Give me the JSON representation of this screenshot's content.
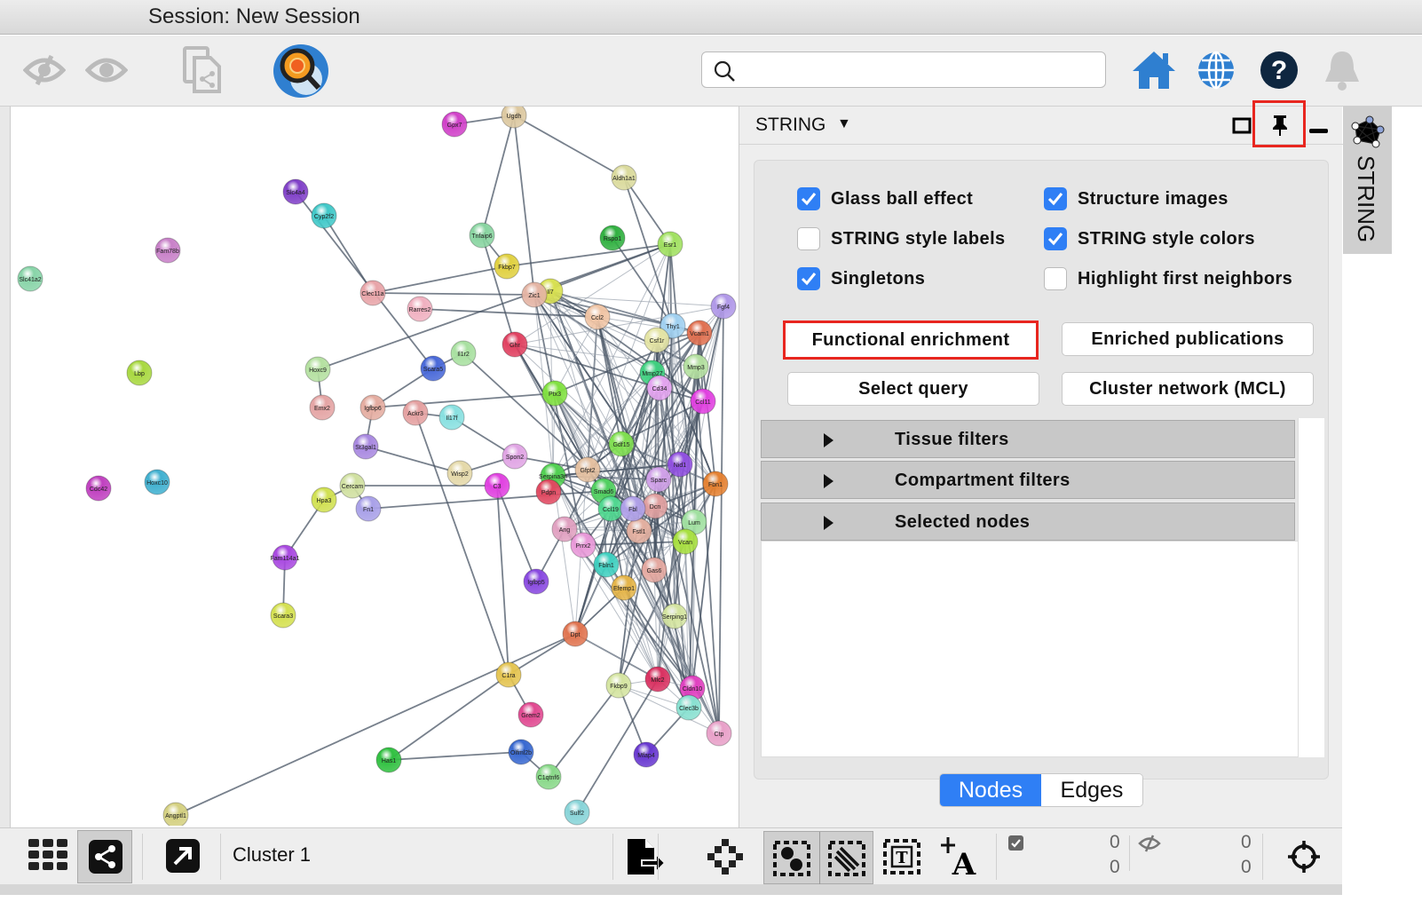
{
  "window": {
    "title": "Session: New Session"
  },
  "toolbar": {
    "icons": [
      "hide-icon",
      "show-icon",
      "new-network-from-selection-icon",
      "string-search-app-icon",
      "home-icon",
      "globe-icon",
      "help-icon",
      "notification-bell-icon"
    ],
    "search_value": "",
    "search_placeholder": ""
  },
  "panel": {
    "title": "STRING",
    "checkboxes": [
      {
        "label": "Glass ball effect",
        "checked": true
      },
      {
        "label": "Structure images",
        "checked": true
      },
      {
        "label": "STRING style labels",
        "checked": false
      },
      {
        "label": "STRING style colors",
        "checked": true
      },
      {
        "label": "Singletons",
        "checked": true
      },
      {
        "label": "Highlight first neighbors",
        "checked": false
      }
    ],
    "buttons": [
      "Functional enrichment",
      "Enriched publications",
      "Select query",
      "Cluster network (MCL)"
    ],
    "highlighted_button": "Functional enrichment",
    "filters": [
      "Tissue filters",
      "Compartment filters",
      "Selected nodes"
    ],
    "segmented": {
      "options": [
        "Nodes",
        "Edges"
      ],
      "selected": "Nodes"
    },
    "accent": "#2f7ff5",
    "highlight_color": "#e8261f"
  },
  "sidetab": {
    "label": "STRING"
  },
  "bottombar": {
    "network_name": "Cluster 1",
    "selected_nodes": "0",
    "selected_edges": "0",
    "hidden_nodes": "0",
    "hidden_edges": "0"
  },
  "network": {
    "nodes": [
      {
        "label": "Gpx7",
        "color": "#d040c8"
      },
      {
        "label": "Ugdh",
        "color": "#dcc8a0"
      },
      {
        "label": "Aldh1a1",
        "color": "#dada9c"
      },
      {
        "label": "Slc4a4",
        "color": "#8040c8"
      },
      {
        "label": "Cyp2f2",
        "color": "#40c8c8"
      },
      {
        "label": "Fam78b",
        "color": "#c880c8"
      },
      {
        "label": "Slc41a2",
        "color": "#88d4a8"
      },
      {
        "label": "Tnfaip6",
        "color": "#88d4a0"
      },
      {
        "label": "Rspo1",
        "color": "#30b040"
      },
      {
        "label": "Esr1",
        "color": "#a0e060"
      },
      {
        "label": "Fkbp7",
        "color": "#e0d040"
      },
      {
        "label": "Il7",
        "color": "#d8e050"
      },
      {
        "label": "Zic1",
        "color": "#e4b4a4"
      },
      {
        "label": "Clec11a",
        "color": "#e8a4a8"
      },
      {
        "label": "Rarres2",
        "color": "#f0b0c0"
      },
      {
        "label": "Ccl2",
        "color": "#f0c4a4"
      },
      {
        "label": "Thy1",
        "color": "#a0d0f0"
      },
      {
        "label": "Vcam1",
        "color": "#e07050"
      },
      {
        "label": "Csf1r",
        "color": "#e4e4a4"
      },
      {
        "label": "Ghr",
        "color": "#e04060"
      },
      {
        "label": "Il1r2",
        "color": "#a8e0a0"
      },
      {
        "label": "Hoxc9",
        "color": "#b4e0a0"
      },
      {
        "label": "Scara5",
        "color": "#4868d8"
      },
      {
        "label": "Lbp",
        "color": "#a8d840"
      },
      {
        "label": "Mmp27",
        "color": "#40d080"
      },
      {
        "label": "Mmp3",
        "color": "#b4e0a0"
      },
      {
        "label": "Cd34",
        "color": "#e4a4f0"
      },
      {
        "label": "Ptx3",
        "color": "#80e040"
      },
      {
        "label": "Emx2",
        "color": "#e4a4a4"
      },
      {
        "label": "Igfbp6",
        "color": "#e4aca0"
      },
      {
        "label": "Ackr3",
        "color": "#e4a0a0"
      },
      {
        "label": "Il17f",
        "color": "#88e0e0"
      },
      {
        "label": "Ccl11",
        "color": "#e040e0"
      },
      {
        "label": "Gdf15",
        "color": "#80e050"
      },
      {
        "label": "Spon2",
        "color": "#e0a4e4"
      },
      {
        "label": "Wisp2",
        "color": "#e4d8a8"
      },
      {
        "label": "C3",
        "color": "#e040e0"
      },
      {
        "label": "St3gal1",
        "color": "#a888e0"
      },
      {
        "label": "Cercam",
        "color": "#d0e0a0"
      },
      {
        "label": "Hpa3",
        "color": "#d0e050"
      },
      {
        "label": "Fn1",
        "color": "#a8a0e8"
      },
      {
        "label": "Serpina3n",
        "color": "#50d050"
      },
      {
        "label": "Pdpn",
        "color": "#e04860"
      },
      {
        "label": "Gfpt2",
        "color": "#e4c0a0"
      },
      {
        "label": "Smad6",
        "color": "#50d060"
      },
      {
        "label": "Ccl19",
        "color": "#50d890"
      },
      {
        "label": "Cdc42",
        "color": "#c040c0"
      },
      {
        "label": "Hoxc10",
        "color": "#40b0d0"
      },
      {
        "label": "Fam114a1",
        "color": "#a848e0"
      },
      {
        "label": "Scara3",
        "color": "#d4e050"
      },
      {
        "label": "Ang",
        "color": "#e0a0c0"
      },
      {
        "label": "Prrx2",
        "color": "#e898d8"
      },
      {
        "label": "Fbln1",
        "color": "#40d0c0"
      },
      {
        "label": "Gas6",
        "color": "#e4a8a0"
      },
      {
        "label": "Igfbp5",
        "color": "#8848e0"
      },
      {
        "label": "Efemp1",
        "color": "#e4b448"
      },
      {
        "label": "Serping1",
        "color": "#d4e4a0"
      },
      {
        "label": "Dpt",
        "color": "#e07450"
      },
      {
        "label": "C1ra",
        "color": "#e4c450"
      },
      {
        "label": "Fkbp9",
        "color": "#d4e4a0"
      },
      {
        "label": "Mfc2",
        "color": "#d83060"
      },
      {
        "label": "Cldn10",
        "color": "#e040c0"
      },
      {
        "label": "Clec3b",
        "color": "#88e0d0"
      },
      {
        "label": "Grem2",
        "color": "#e04890"
      },
      {
        "label": "Has1",
        "color": "#30c040"
      },
      {
        "label": "Olfml2b",
        "color": "#3868d0"
      },
      {
        "label": "Mfap4",
        "color": "#6838d0"
      },
      {
        "label": "C1qtnf6",
        "color": "#88d888"
      },
      {
        "label": "Angptl1",
        "color": "#d4d080"
      },
      {
        "label": "Sulf2",
        "color": "#88d4d8"
      },
      {
        "label": "Fbn1",
        "color": "#e48030"
      },
      {
        "label": "Nid1",
        "color": "#9050e0"
      },
      {
        "label": "Lum",
        "color": "#a0e0a0"
      },
      {
        "label": "Vcan",
        "color": "#a8e040"
      },
      {
        "label": "Fstl1",
        "color": "#e4b0a0"
      },
      {
        "label": "Dcn",
        "color": "#e0a0a0"
      },
      {
        "label": "Fbl",
        "color": "#b0a0e8"
      },
      {
        "label": "Sparc",
        "color": "#d0a0e8"
      },
      {
        "label": "Ctp",
        "color": "#e8a0c8"
      },
      {
        "label": "Fgf4",
        "color": "#b098e8"
      }
    ]
  }
}
